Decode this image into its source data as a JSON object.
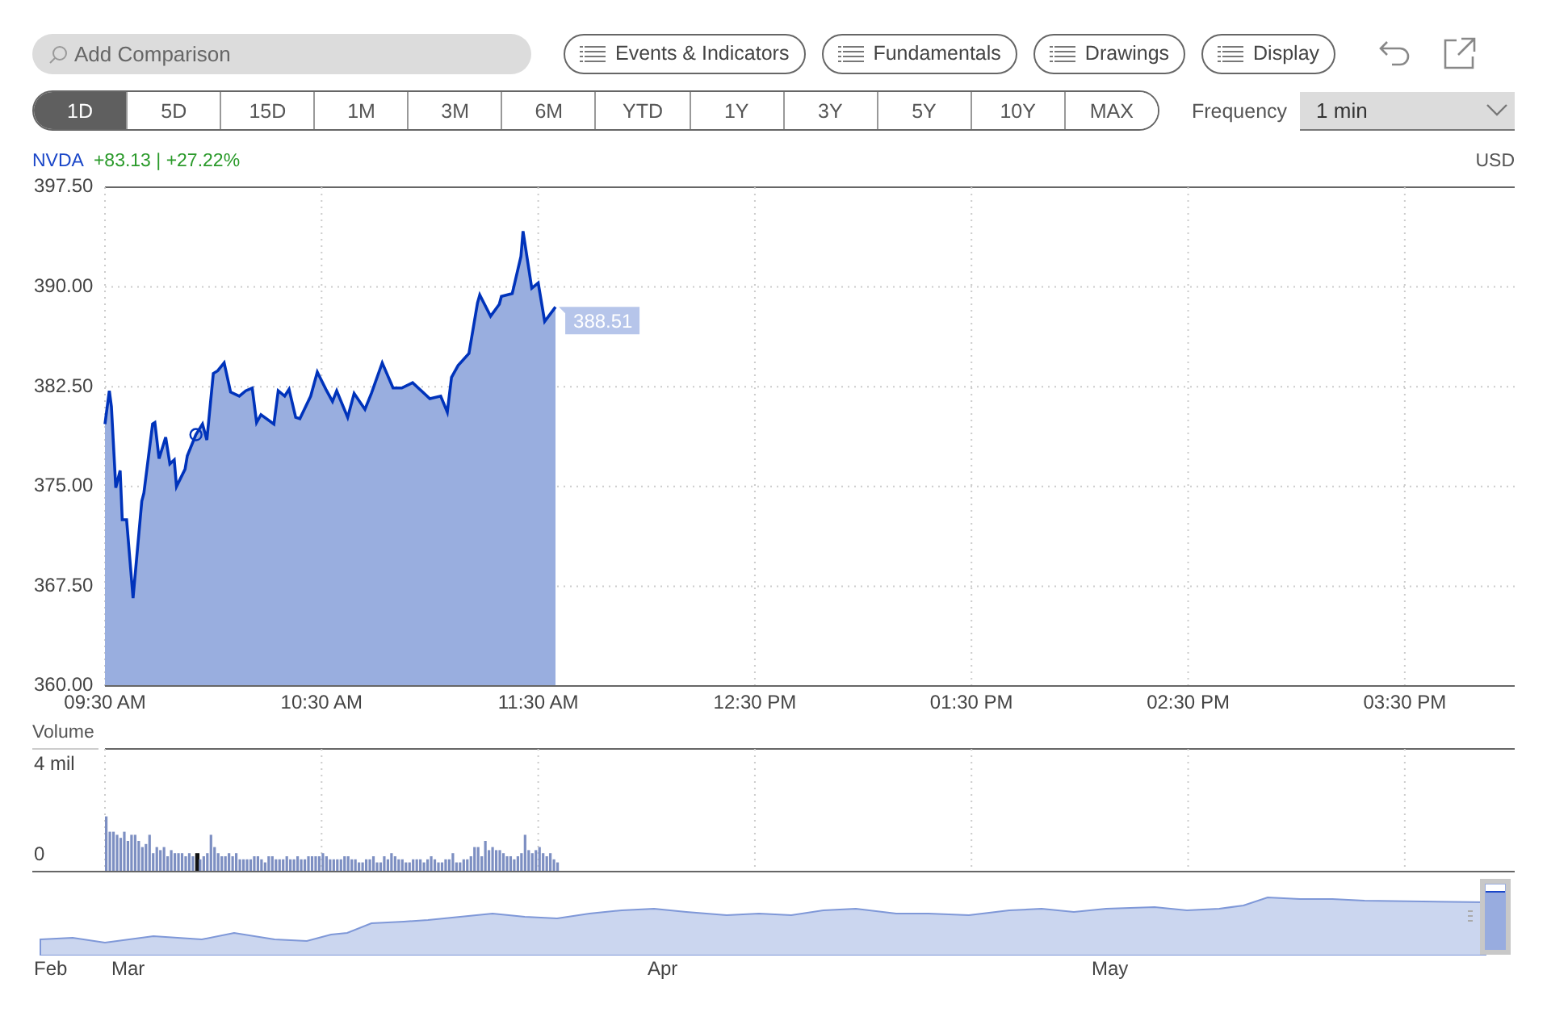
{
  "toolbar": {
    "search": {
      "placeholder": "Add Comparison"
    },
    "buttons": [
      {
        "label": "Events & Indicators"
      },
      {
        "label": "Fundamentals"
      },
      {
        "label": "Drawings"
      },
      {
        "label": "Display"
      }
    ]
  },
  "ranges": [
    {
      "label": "1D",
      "selected": true
    },
    {
      "label": "5D",
      "selected": false
    },
    {
      "label": "15D",
      "selected": false
    },
    {
      "label": "1M",
      "selected": false
    },
    {
      "label": "3M",
      "selected": false
    },
    {
      "label": "6M",
      "selected": false
    },
    {
      "label": "YTD",
      "selected": false
    },
    {
      "label": "1Y",
      "selected": false
    },
    {
      "label": "3Y",
      "selected": false
    },
    {
      "label": "5Y",
      "selected": false
    },
    {
      "label": "10Y",
      "selected": false
    },
    {
      "label": "MAX",
      "selected": false
    }
  ],
  "frequency": {
    "label": "Frequency",
    "value": "1 min"
  },
  "quote": {
    "symbol": "NVDA",
    "change": "+83.13 | +27.22%",
    "currency": "USD"
  },
  "price_chart": {
    "last_price": "388.51",
    "chart_data": {
      "type": "area",
      "grid": true,
      "xlim": [
        9.5,
        16
      ],
      "ylim": [
        360,
        397.5
      ],
      "xticks": [
        {
          "value": 9.5,
          "label": "09:30 AM"
        },
        {
          "value": 10.5,
          "label": "10:30 AM"
        },
        {
          "value": 11.5,
          "label": "11:30 AM"
        },
        {
          "value": 12.5,
          "label": "12:30 PM"
        },
        {
          "value": 13.5,
          "label": "01:30 PM"
        },
        {
          "value": 14.5,
          "label": "02:30 PM"
        },
        {
          "value": 15.5,
          "label": "03:30 PM"
        }
      ],
      "yticks": [
        {
          "value": 397.5,
          "label": "397.50"
        },
        {
          "value": 390,
          "label": "390.00"
        },
        {
          "value": 382.5,
          "label": "382.50"
        },
        {
          "value": 375,
          "label": "375.00"
        },
        {
          "value": 367.5,
          "label": "367.50"
        },
        {
          "value": 360,
          "label": "360.00"
        }
      ],
      "x": [
        9.5,
        9.52,
        9.53,
        9.55,
        9.57,
        9.58,
        9.6,
        9.63,
        9.67,
        9.68,
        9.72,
        9.73,
        9.75,
        9.78,
        9.8,
        9.82,
        9.83,
        9.87,
        9.88,
        9.92,
        9.95,
        9.97,
        10.0,
        10.02,
        10.05,
        10.08,
        10.12,
        10.15,
        10.18,
        10.2,
        10.22,
        10.28,
        10.3,
        10.33,
        10.35,
        10.38,
        10.4,
        10.45,
        10.48,
        10.52,
        10.55,
        10.57,
        10.62,
        10.65,
        10.7,
        10.73,
        10.78,
        10.83,
        10.87,
        10.92,
        11.0,
        11.05,
        11.08,
        11.1,
        11.13,
        11.18,
        11.22,
        11.23,
        11.28,
        11.32,
        11.33,
        11.38,
        11.42,
        11.43,
        11.47,
        11.5,
        11.53,
        11.58
      ],
      "series": [
        {
          "color": "#0033bb",
          "values": [
            379.7,
            382.2,
            381.0,
            374.9,
            376.2,
            372.5,
            372.5,
            366.6,
            373.9,
            374.5,
            379.7,
            379.8,
            377.1,
            378.7,
            376.7,
            377.0,
            375.0,
            376.3,
            377.3,
            378.9,
            379.7,
            378.5,
            383.5,
            383.7,
            384.3,
            382.1,
            381.8,
            382.2,
            382.4,
            379.8,
            380.4,
            379.7,
            382.2,
            381.8,
            382.3,
            380.2,
            380.1,
            381.8,
            383.6,
            382.3,
            381.4,
            382.2,
            380.2,
            382.0,
            380.8,
            382.0,
            384.3,
            382.4,
            382.4,
            382.8,
            381.6,
            381.8,
            380.6,
            383.2,
            384.1,
            385.0,
            388.8,
            389.4,
            387.8,
            388.7,
            389.3,
            389.5,
            392.3,
            394.2,
            389.9,
            390.3,
            387.4,
            388.5
          ]
        }
      ]
    }
  },
  "volume_chart": {
    "label": "Volume",
    "axis_labels": [
      "4 mil",
      "0"
    ]
  },
  "navigator": {
    "months": [
      "Feb",
      "Mar",
      "Apr",
      "May"
    ]
  }
}
